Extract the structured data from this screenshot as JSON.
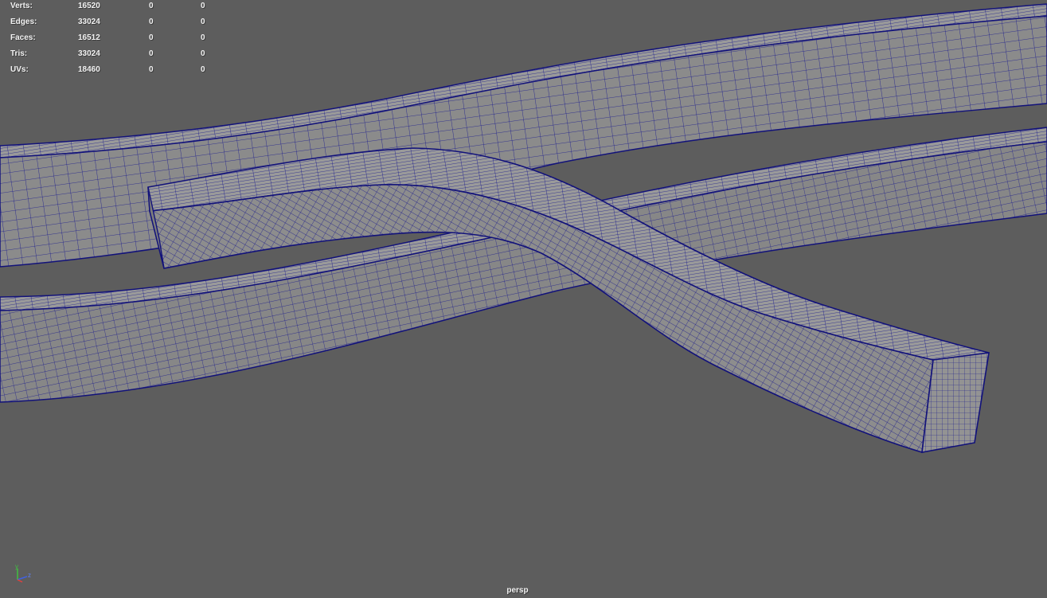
{
  "viewport": {
    "camera": "persp",
    "background_color": "#5d5d5d",
    "wireframe_color": "#1a1a8c",
    "shaded_color": "#8a8a8a"
  },
  "heads_up_display": {
    "rows": [
      {
        "label": "Verts:",
        "total": "16520",
        "selected": "0",
        "component": "0"
      },
      {
        "label": "Edges:",
        "total": "33024",
        "selected": "0",
        "component": "0"
      },
      {
        "label": "Faces:",
        "total": "16512",
        "selected": "0",
        "component": "0"
      },
      {
        "label": "Tris:",
        "total": "33024",
        "selected": "0",
        "component": "0"
      },
      {
        "label": "UVs:",
        "total": "18460",
        "selected": "0",
        "component": "0"
      }
    ]
  },
  "axis_gizmo": {
    "icon": "view-axis-icon",
    "labels": {
      "y": "y",
      "z": "z"
    },
    "colors": {
      "x": "#e04040",
      "y": "#40c040",
      "z": "#4060e0"
    }
  }
}
